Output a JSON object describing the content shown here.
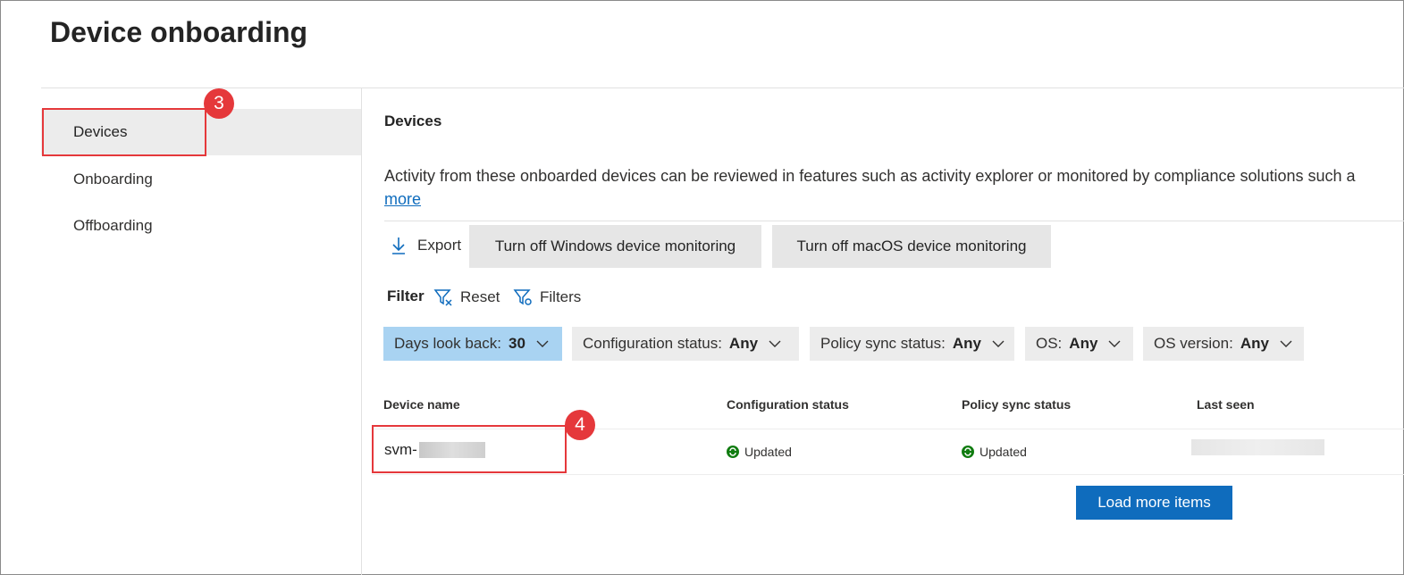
{
  "page": {
    "title": "Device onboarding"
  },
  "sidebar": {
    "items": [
      {
        "label": "Devices",
        "active": true
      },
      {
        "label": "Onboarding"
      },
      {
        "label": "Offboarding"
      }
    ]
  },
  "callouts": {
    "devices_nav": "3",
    "device_row": "4",
    "color": "#e5383b"
  },
  "main": {
    "section_title": "Devices",
    "description": "Activity from these onboarded devices can be reviewed in features such as activity explorer or monitored by compliance solutions such a",
    "more_link": "more",
    "toolbar": {
      "export_label": "Export",
      "turn_off_windows_label": "Turn off Windows device monitoring",
      "turn_off_macos_label": "Turn off macOS device monitoring"
    },
    "filter_bar": {
      "label": "Filter",
      "reset_label": "Reset",
      "filters_label": "Filters"
    },
    "filter_pills": [
      {
        "label": "Days look back:",
        "value": "30",
        "active": true
      },
      {
        "label": "Configuration status:",
        "value": "Any"
      },
      {
        "label": "Policy sync status:",
        "value": "Any"
      },
      {
        "label": "OS:",
        "value": "Any"
      },
      {
        "label": "OS version:",
        "value": "Any"
      }
    ],
    "table": {
      "columns": [
        "Device name",
        "Configuration status",
        "Policy sync status",
        "Last seen"
      ],
      "rows": [
        {
          "device_name": "svm-",
          "configuration_status": "Updated",
          "policy_sync_status": "Updated",
          "last_seen": ""
        }
      ]
    },
    "load_more_label": "Load more items"
  },
  "colors": {
    "accent": "#0f6cbd",
    "active_pill": "#a9d3f2",
    "status_ok": "#107c10"
  }
}
